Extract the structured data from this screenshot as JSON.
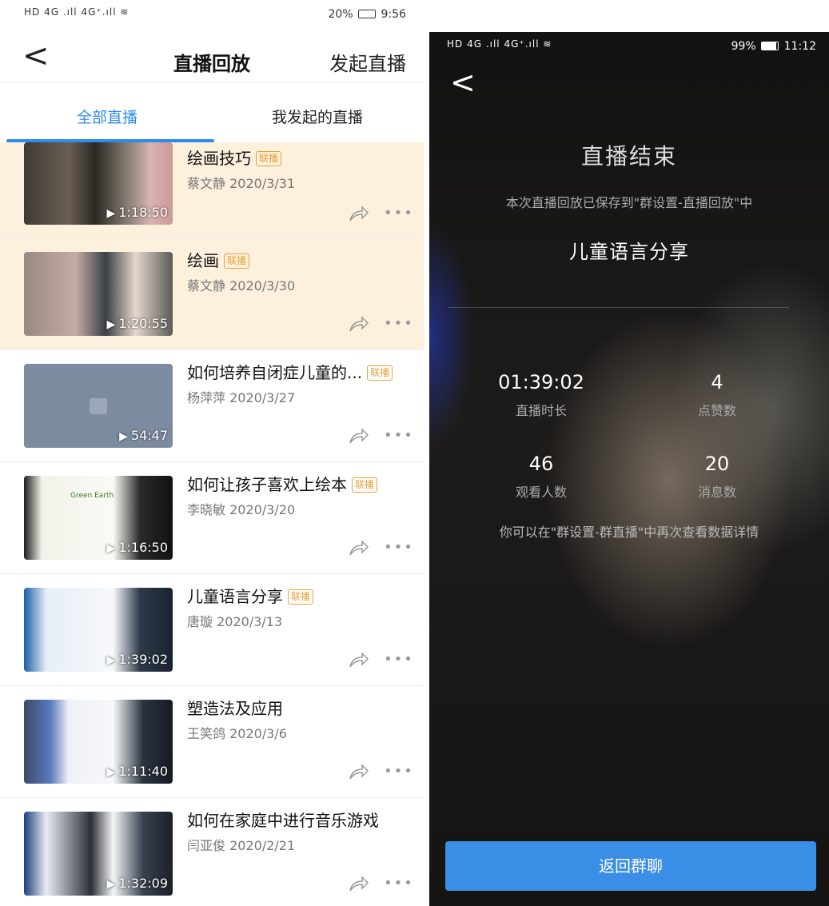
{
  "left": {
    "status": {
      "signal": "HD 4G .ıll 4G⁺.ıll ≋",
      "battery": "20%",
      "time": "9:56"
    },
    "nav": {
      "back": "<",
      "title": "直播回放",
      "start_live": "发起直播"
    },
    "tabs": [
      "全部直播",
      "我发起的直播"
    ],
    "badge": "联播",
    "items": [
      {
        "title": "绘画技巧",
        "badge": true,
        "author": "蔡文静",
        "date": "2020/3/31",
        "duration": "1:18:50"
      },
      {
        "title": "绘画",
        "badge": true,
        "author": "蔡文静",
        "date": "2020/3/30",
        "duration": "1:20:55"
      },
      {
        "title": "如何培养自闭症儿童的...",
        "badge": true,
        "author": "杨萍萍",
        "date": "2020/3/27",
        "duration": "54:47"
      },
      {
        "title": "如何让孩子喜欢上绘本",
        "badge": true,
        "author": "李晓敏",
        "date": "2020/3/20",
        "duration": "1:16:50"
      },
      {
        "title": "儿童语言分享",
        "badge": true,
        "author": "唐璇",
        "date": "2020/3/13",
        "duration": "1:39:02"
      },
      {
        "title": "塑造法及应用",
        "badge": false,
        "author": "王笑鸽",
        "date": "2020/3/6",
        "duration": "1:11:40"
      },
      {
        "title": "如何在家庭中进行音乐游戏",
        "badge": false,
        "author": "闫亚俊",
        "date": "2020/2/21",
        "duration": "1:32:09"
      }
    ],
    "thumb_text": "Green Earth"
  },
  "right": {
    "status": {
      "signal": "HD 4G .ıll 4G⁺.ıll ≋",
      "battery": "99%",
      "time": "11:12"
    },
    "back": "<",
    "end_title": "直播结束",
    "saved_note": "本次直播回放已保存到\"群设置-直播回放\"中",
    "topic": "儿童语言分享",
    "stats": {
      "duration": {
        "value": "01:39:02",
        "label": "直播时长"
      },
      "likes": {
        "value": "4",
        "label": "点赞数"
      },
      "viewers": {
        "value": "46",
        "label": "观看人数"
      },
      "messages": {
        "value": "20",
        "label": "消息数"
      }
    },
    "hint": "你可以在\"群设置-群直播\"中再次查看数据详情",
    "return_button": "返回群聊"
  },
  "colors": {
    "accent": "#2d8cf0",
    "badge": "#e8a13a",
    "highlight": "#fdf0dc",
    "button": "#3a8ee6"
  }
}
